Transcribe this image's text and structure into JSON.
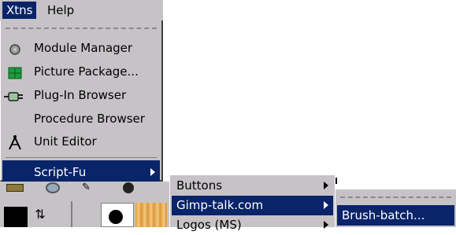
{
  "menubar": {
    "items": [
      {
        "label": "Xtns"
      },
      {
        "label": "Help"
      }
    ]
  },
  "xtns_menu": {
    "items": [
      {
        "label": "Module Manager",
        "icon": "gear-icon"
      },
      {
        "label": "Picture Package...",
        "icon": "picture-package-icon"
      },
      {
        "label": "Plug-In Browser",
        "icon": "plug-icon"
      },
      {
        "label": "Procedure Browser",
        "icon": ""
      },
      {
        "label": "Unit Editor",
        "icon": "compass-icon"
      },
      {
        "label": "Script-Fu",
        "icon": "",
        "selected": true,
        "submenu": true
      }
    ]
  },
  "scriptfu_menu": {
    "items": [
      {
        "label": "Buttons",
        "submenu": true
      },
      {
        "label": "Gimp-talk.com",
        "submenu": true,
        "selected": true
      },
      {
        "label": "Logos (MS)",
        "submenu": true
      }
    ]
  },
  "gimptalk_menu": {
    "items": [
      {
        "label": "Brush-batch...",
        "selected": true
      }
    ]
  },
  "colors": {
    "menu_bg": "#c6c3c6",
    "highlight": "#0a246a",
    "highlight_text": "#ffffff"
  }
}
